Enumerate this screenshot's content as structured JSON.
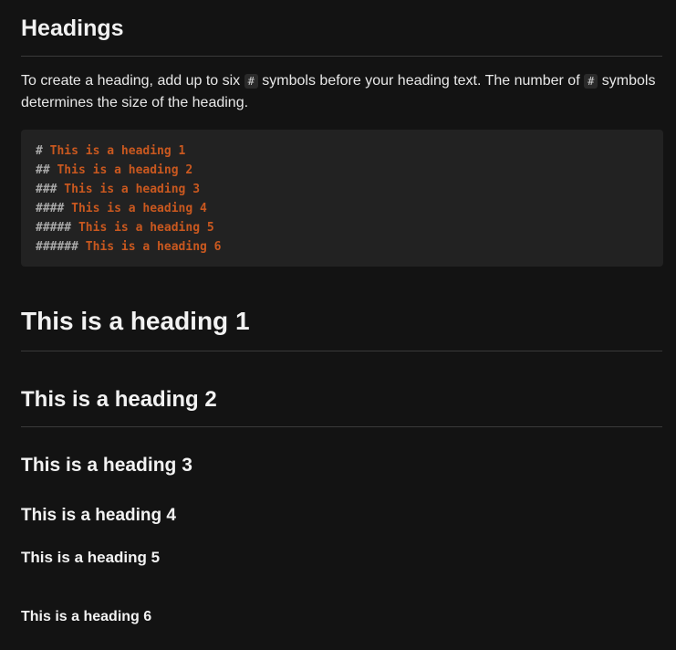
{
  "section": {
    "title": "Headings"
  },
  "intro": {
    "text_1": "To create a heading, add up to six ",
    "code_1": "#",
    "text_2": " symbols before your heading text. The number of ",
    "code_2": "#",
    "text_3": " symbols determines the size of the heading."
  },
  "code_block": {
    "lines": [
      {
        "hashes": "#",
        "text": " This is a heading 1"
      },
      {
        "hashes": "##",
        "text": " This is a heading 2"
      },
      {
        "hashes": "###",
        "text": " This is a heading 3"
      },
      {
        "hashes": "####",
        "text": " This is a heading 4"
      },
      {
        "hashes": "#####",
        "text": " This is a heading 5"
      },
      {
        "hashes": "######",
        "text": " This is a heading 6"
      }
    ],
    "colors": {
      "hash": "#a9a9a9",
      "heading_text": "#c9581f",
      "background": "#222222"
    }
  },
  "rendered_headings": {
    "h1": "This is a heading 1",
    "h2": "This is a heading 2",
    "h3": "This is a heading 3",
    "h4": "This is a heading 4",
    "h5": "This is a heading 5",
    "h6": "This is a heading 6"
  },
  "theme": {
    "page_background": "#131313",
    "heading_color": "#f2f2f2",
    "rule_color": "#3a3a3a"
  }
}
